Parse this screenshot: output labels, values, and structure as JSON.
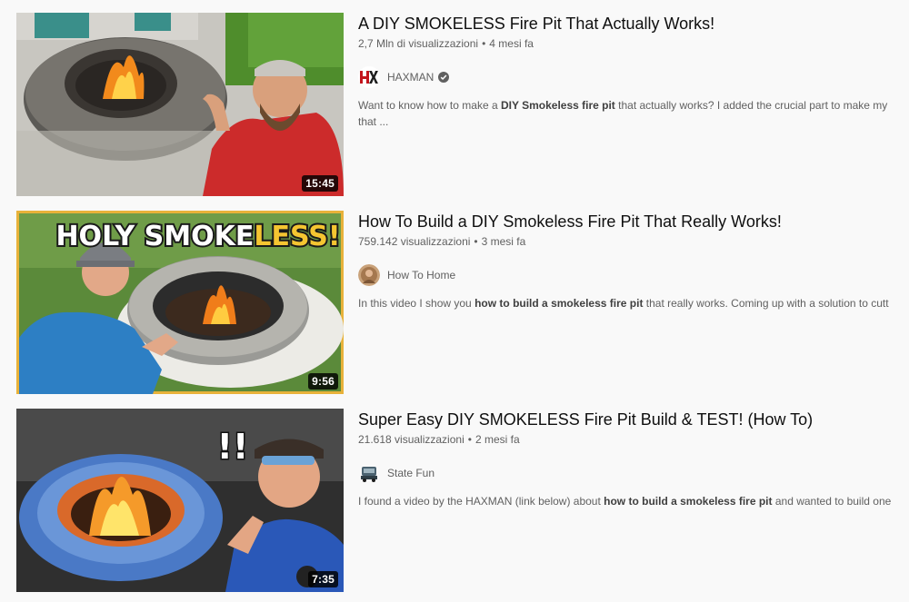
{
  "videos": [
    {
      "title": "A DIY SMOKELESS Fire Pit That Actually Works!",
      "views": "2,7 Mln di visualizzazioni",
      "age": "4 mesi fa",
      "channel": "HAXMAN",
      "verified": true,
      "desc_pre": "Want to know how to make a ",
      "desc_bold": "DIY Smokeless fire pit",
      "desc_post": " that actually works? I added the crucial part to make my",
      "desc_line2": "that ...",
      "duration": "15:45",
      "avatar_icon": "haxman-logo-icon"
    },
    {
      "title": "How To Build a DIY Smokeless Fire Pit That Really Works!",
      "views": "759.142 visualizzazioni",
      "age": "3 mesi fa",
      "channel": "How To Home",
      "verified": false,
      "desc_pre": "In this video I show you ",
      "desc_bold": "how to build a smokeless fire pit",
      "desc_post": " that really works. Coming up with a solution to cutt",
      "desc_line2": "",
      "duration": "9:56",
      "avatar_icon": "how-to-home-avatar-icon",
      "thumb_text_white": "HOLY SMOKE",
      "thumb_text_yellow": "LESS!"
    },
    {
      "title": "Super Easy DIY SMOKELESS Fire Pit Build & TEST! (How To)",
      "views": "21.618 visualizzazioni",
      "age": "2 mesi fa",
      "channel": "State Fun",
      "verified": false,
      "desc_pre": "I found a video by the HAXMAN (link below) about ",
      "desc_bold": "how to build a smokeless fire pit",
      "desc_post": " and wanted to build one",
      "desc_line2": "",
      "duration": "7:35",
      "avatar_icon": "state-fun-avatar-icon",
      "thumb_text_white": "!!"
    }
  ],
  "separator": "•",
  "colors": {
    "background": "#f9f9f9",
    "title": "#0f0f0f",
    "meta": "#606060",
    "duration_bg": "#000000",
    "thumb_border_yellow": "#e8b23a"
  }
}
